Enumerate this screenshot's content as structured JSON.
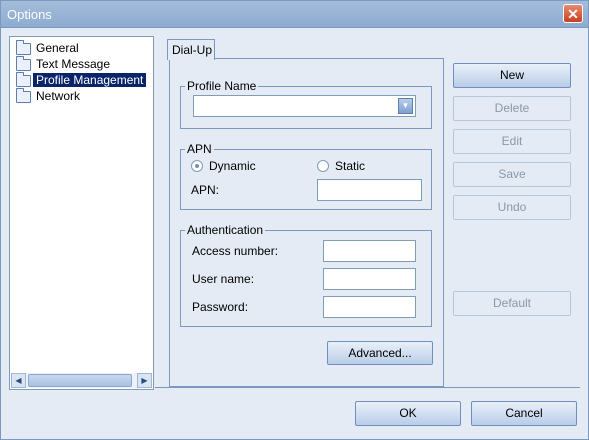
{
  "window": {
    "title": "Options",
    "close_label": "✕"
  },
  "tree": {
    "items": [
      {
        "label": "General",
        "selected": false
      },
      {
        "label": "Text Message",
        "selected": false
      },
      {
        "label": "Profile Management",
        "selected": true
      },
      {
        "label": "Network",
        "selected": false
      }
    ]
  },
  "tab": {
    "label": "Dial-Up"
  },
  "profile": {
    "legend": "Profile Name",
    "value": ""
  },
  "apn": {
    "legend": "APN",
    "dynamic_label": "Dynamic",
    "static_label": "Static",
    "selected": "Dynamic",
    "apn_label": "APN:",
    "apn_value": ""
  },
  "auth": {
    "legend": "Authentication",
    "access_label": "Access number:",
    "access_value": "",
    "user_label": "User name:",
    "user_value": "",
    "password_label": "Password:",
    "password_value": ""
  },
  "buttons": {
    "new": "New",
    "delete": "Delete",
    "edit": "Edit",
    "save": "Save",
    "undo": "Undo",
    "default": "Default",
    "advanced": "Advanced...",
    "ok": "OK",
    "cancel": "Cancel"
  }
}
